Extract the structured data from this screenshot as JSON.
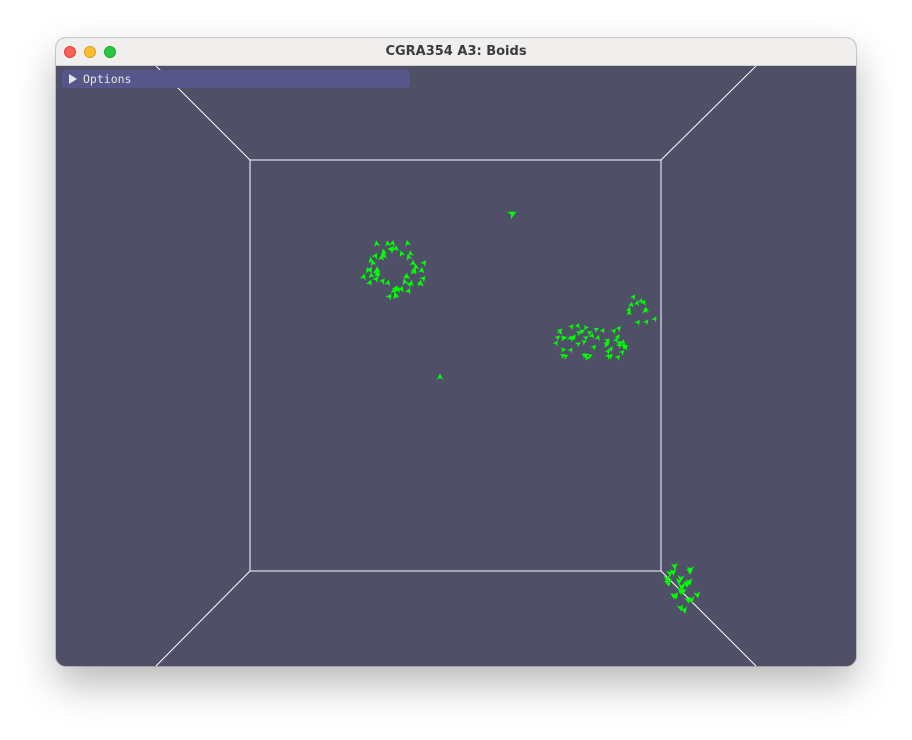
{
  "window": {
    "title": "CGRA354 A3: Boids"
  },
  "toolbar": {
    "options_label": "Options",
    "options_expanded": false
  },
  "scene": {
    "background_color": "#4f4f68",
    "wireframe_color": "#ffffff",
    "boid_color": "#00ff00",
    "boid_count_visible": 151
  }
}
